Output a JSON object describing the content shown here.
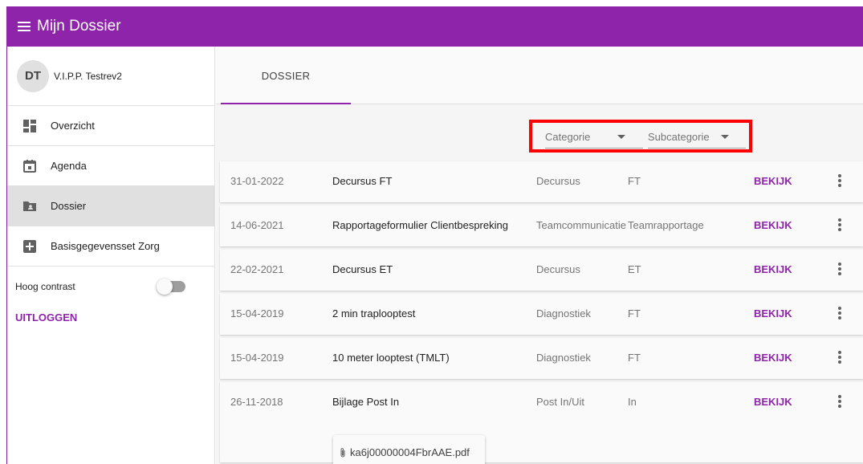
{
  "topbar": {
    "title": "Mijn Dossier"
  },
  "user": {
    "initials": "DT",
    "name": "V.I.P.P. Testrev2"
  },
  "sidebar": {
    "items": [
      {
        "label": "Overzicht",
        "icon": "dashboard-icon"
      },
      {
        "label": "Agenda",
        "icon": "calendar-icon"
      },
      {
        "label": "Dossier",
        "icon": "folder-shared-icon",
        "active": true
      },
      {
        "label": "Basisgegevensset Zorg",
        "icon": "medical-plus-icon"
      }
    ],
    "contrast_label": "Hoog contrast",
    "contrast_on": false,
    "logout_label": "UITLOGGEN"
  },
  "tabs": [
    {
      "label": "DOSSIER",
      "active": true
    }
  ],
  "filters": {
    "category_placeholder": "Categorie",
    "subcategory_placeholder": "Subcategorie"
  },
  "colors": {
    "primary": "#8e24aa",
    "highlight_border": "#ff0000"
  },
  "records": [
    {
      "date": "31-01-2022",
      "title": "Decursus FT",
      "category": "Decursus",
      "subcategory": "FT",
      "action": "BEKIJK"
    },
    {
      "date": "14-06-2021",
      "title": "Rapportageformulier Clientbespreking",
      "category": "Teamcommunicatie",
      "subcategory": "Teamrapportage",
      "action": "BEKIJK"
    },
    {
      "date": "22-02-2021",
      "title": "Decursus ET",
      "category": "Decursus",
      "subcategory": "ET",
      "action": "BEKIJK"
    },
    {
      "date": "15-04-2019",
      "title": "2 min traplooptest",
      "category": "Diagnostiek",
      "subcategory": "FT",
      "action": "BEKIJK"
    },
    {
      "date": "15-04-2019",
      "title": "10 meter looptest (TMLT)",
      "category": "Diagnostiek",
      "subcategory": "FT",
      "action": "BEKIJK"
    },
    {
      "date": "26-11-2018",
      "title": "Bijlage Post In",
      "category": "Post In/Uit",
      "subcategory": "In",
      "action": "BEKIJK",
      "attachment": "ka6j00000004FbrAAE.pdf"
    }
  ]
}
